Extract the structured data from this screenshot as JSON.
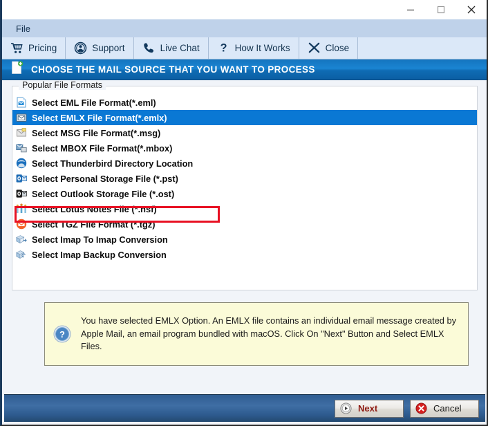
{
  "window": {
    "minimize_label": "minimize",
    "maximize_label": "maximize",
    "close_label": "close"
  },
  "menubar": {
    "items": [
      {
        "label": "File",
        "name": "menu-file"
      }
    ]
  },
  "toolbar": {
    "items": [
      {
        "label": "Pricing",
        "icon": "shopping-cart-icon"
      },
      {
        "label": "Support",
        "icon": "support-person-icon"
      },
      {
        "label": "Live Chat",
        "icon": "phone-icon"
      },
      {
        "label": "How It Works",
        "icon": "question-mark-icon"
      },
      {
        "label": "Close",
        "icon": "x-cross-icon"
      }
    ]
  },
  "banner": {
    "icon": "document-add-icon",
    "title": "CHOOSE THE MAIL SOURCE THAT YOU WANT TO PROCESS"
  },
  "groupbox": {
    "legend": "Popular File Formats",
    "items": [
      {
        "label": "Select EML File Format(*.eml)",
        "icon": "eml-file-icon",
        "selected": false
      },
      {
        "label": "Select EMLX File Format(*.emlx)",
        "icon": "emlx-file-icon",
        "selected": true
      },
      {
        "label": "Select MSG File Format(*.msg)",
        "icon": "msg-file-icon",
        "selected": false
      },
      {
        "label": "Select MBOX File Format(*.mbox)",
        "icon": "mbox-file-icon",
        "selected": false
      },
      {
        "label": "Select Thunderbird Directory Location",
        "icon": "thunderbird-icon",
        "selected": false
      },
      {
        "label": "Select Personal Storage File (*.pst)",
        "icon": "outlook-pst-icon",
        "selected": false
      },
      {
        "label": "Select Outlook Storage File (*.ost)",
        "icon": "outlook-ost-icon",
        "selected": false
      },
      {
        "label": "Select Lotus Notes File (*.nsf)",
        "icon": "lotus-notes-icon",
        "selected": false
      },
      {
        "label": "Select TGZ File Format (*.tgz)",
        "icon": "tgz-envelope-icon",
        "selected": false
      },
      {
        "label": "Select Imap To Imap Conversion",
        "icon": "imap-to-imap-icon",
        "selected": false
      },
      {
        "label": "Select Imap Backup Conversion",
        "icon": "imap-backup-icon",
        "selected": false
      }
    ]
  },
  "annotation": {
    "name": "red-highlight-box",
    "color": "#e81123"
  },
  "infobox": {
    "icon": "question-circle-icon",
    "text": "You have selected EMLX Option. An EMLX file contains an individual email message created by Apple Mail, an email program bundled with macOS. Click On \"Next\" Button and Select EMLX Files."
  },
  "footer": {
    "next_label": "Next",
    "cancel_label": "Cancel"
  },
  "colors": {
    "selection_blue": "#0a78d4",
    "banner_blue": "#1a85d2",
    "annotation_red": "#e81123",
    "toolbar_bg": "#dbe8f8",
    "menubar_bg": "#bfd2ea",
    "info_bg": "#fbfbd8",
    "page_bg": "#f1f4f9"
  }
}
